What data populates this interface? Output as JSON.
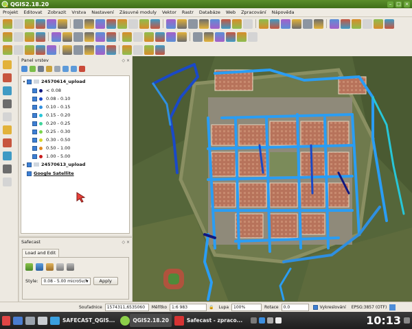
{
  "window": {
    "title": "QGIS2.18.20"
  },
  "menu": [
    "Projekt",
    "Editovat",
    "Zobrazit",
    "Vrstva",
    "Nastavení",
    "Zásuvné moduly",
    "Vektor",
    "Rastr",
    "Databáze",
    "Web",
    "Zpracování",
    "Nápověda"
  ],
  "layers_panel": {
    "title": "Panel vrstev",
    "layers": [
      {
        "name": "24570614_upload",
        "expanded": true,
        "classes": [
          {
            "label": "< 0.08",
            "color": "#101880"
          },
          {
            "label": "0.08 - 0.10",
            "color": "#1a49c7"
          },
          {
            "label": "0.10 - 0.15",
            "color": "#2f8fe0"
          },
          {
            "label": "0.15 - 0.20",
            "color": "#27c6d8"
          },
          {
            "label": "0.20 - 0.25",
            "color": "#3fd49a"
          },
          {
            "label": "0.25 - 0.30",
            "color": "#7ad64a"
          },
          {
            "label": "0.30 - 0.50",
            "color": "#d8d32a"
          },
          {
            "label": "0.50 - 1.00",
            "color": "#e48a1e"
          },
          {
            "label": "1.00 - 5.00",
            "color": "#c91b1b"
          }
        ]
      },
      {
        "name": "24570613_upload",
        "expanded": false
      },
      {
        "name": "Google Satellite"
      }
    ]
  },
  "safecast": {
    "title": "Safecast",
    "tab": "Load and Edit",
    "style_label": "Style:",
    "style_value": "0.08 - 5.00 microSv/h",
    "apply_label": "Apply"
  },
  "status": {
    "coord_label": "Souřadnice",
    "coord_value": "1574311,6535060",
    "scale_label": "Měřítko",
    "scale_value": "1:6 983",
    "zoom_label": "Lupa",
    "zoom_value": "100%",
    "rotation_label": "Rotace",
    "rotation_value": "0.0",
    "render_label": "Vykreslování",
    "crs_label": "EPSG:3857 (OTF)"
  },
  "taskbar": {
    "tasks": [
      "SAFECAST_QGIS...",
      "QGIS2.18.20",
      "Safecast - zpraco..."
    ],
    "clock": "10:13"
  },
  "colors": {
    "accent_green": "#4b7f22",
    "track_blue": "#2a9df4"
  }
}
